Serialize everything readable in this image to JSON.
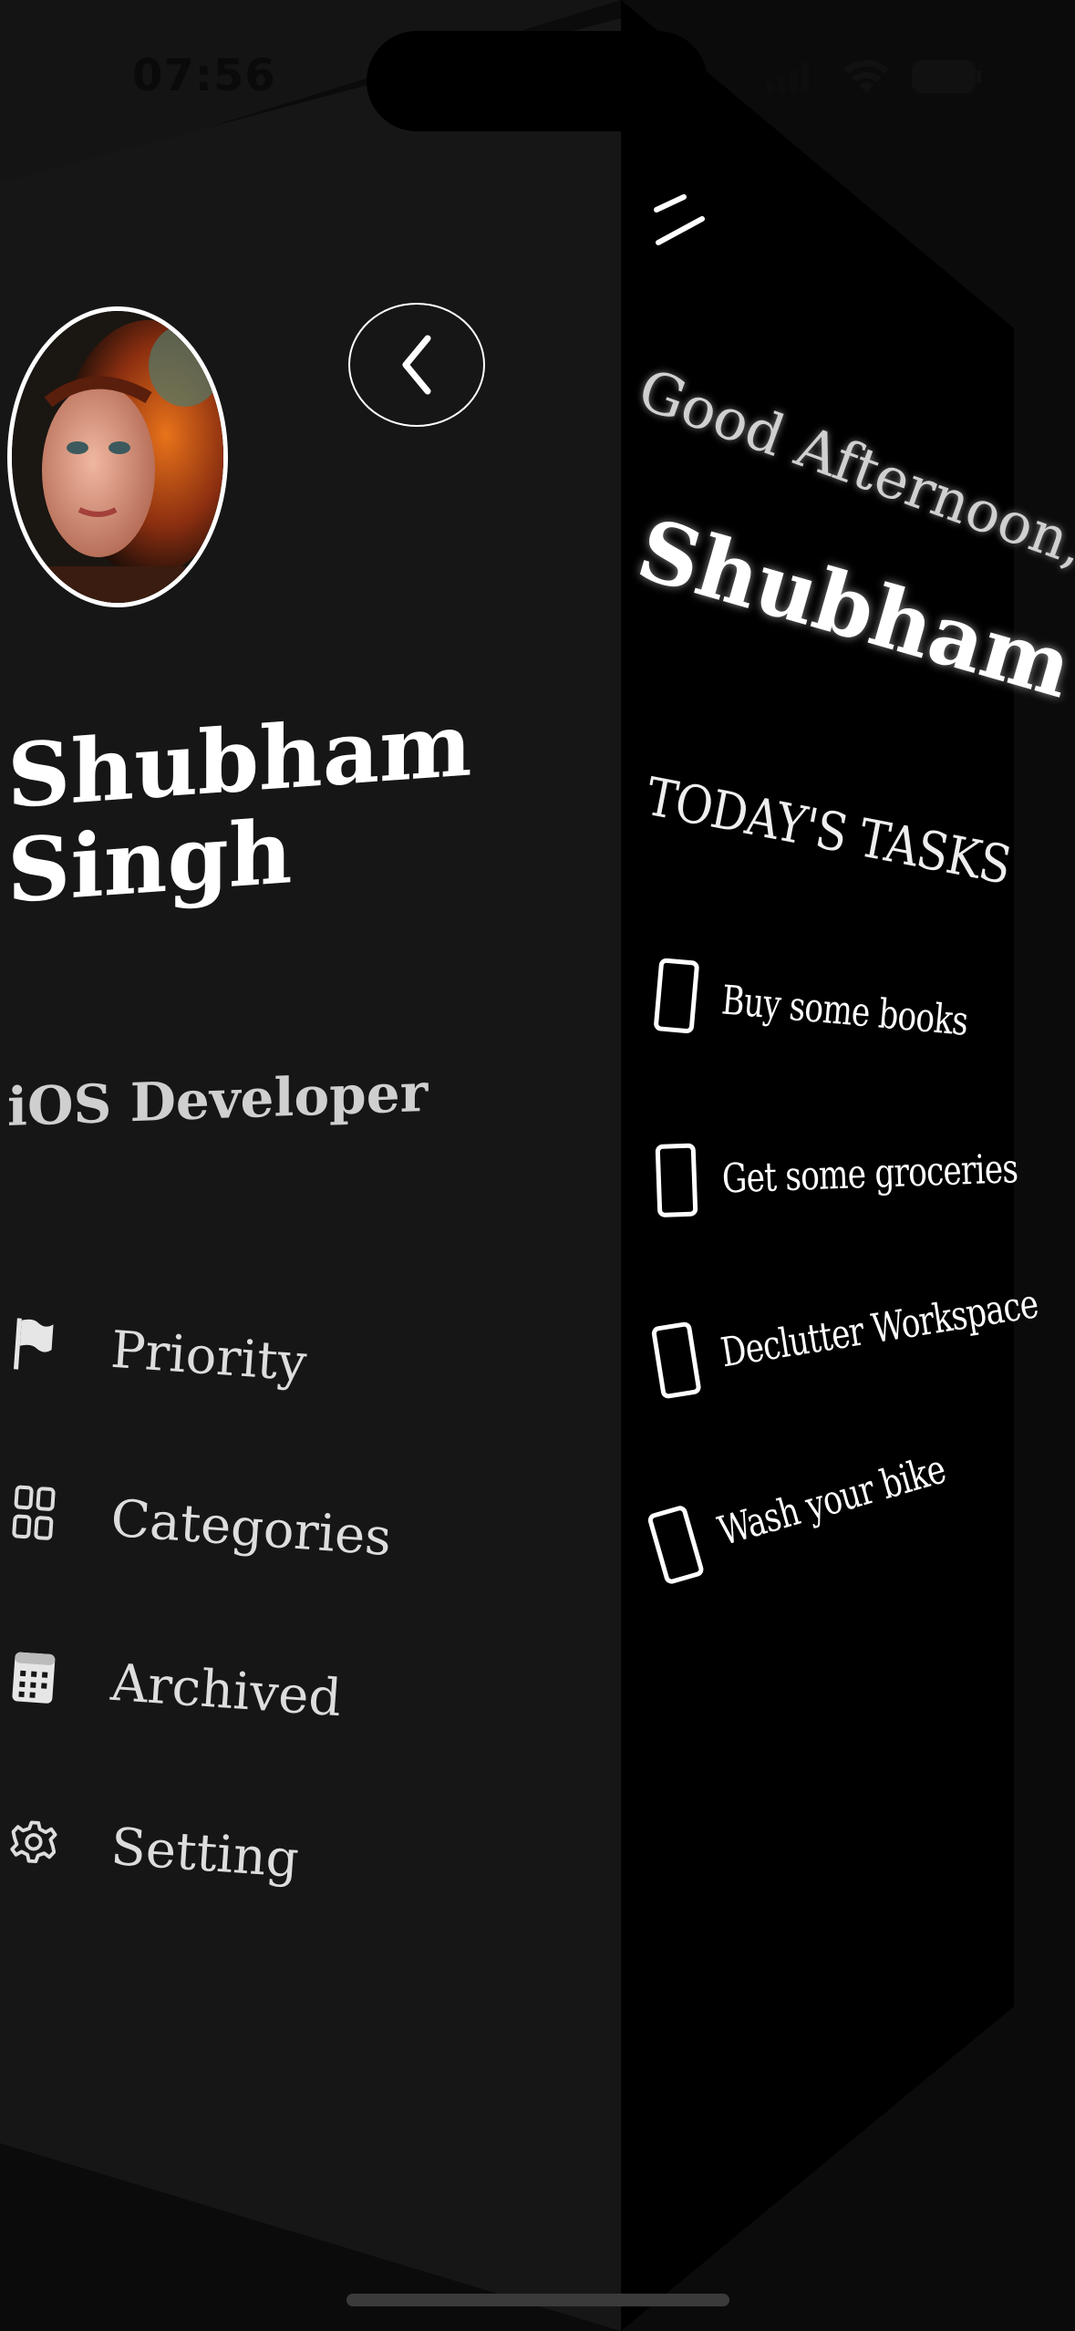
{
  "status_bar": {
    "time": "07:56",
    "icons": [
      "cellular-icon",
      "wifi-icon",
      "battery-icon"
    ]
  },
  "drawer": {
    "avatar_alt": "profile-avatar",
    "back_icon": "chevron-left-icon",
    "name_line1": "Shubham",
    "name_line2": "Singh",
    "role": "iOS Developer",
    "menu": [
      {
        "label": "Priority",
        "icon": "flag-icon"
      },
      {
        "label": "Categories",
        "icon": "grid-icon"
      },
      {
        "label": "Archived",
        "icon": "calendar-icon"
      },
      {
        "label": "Setting",
        "icon": "gear-icon"
      }
    ]
  },
  "main": {
    "menu_icon": "menu-toggle-icon",
    "greeting": "Good Afternoon,",
    "user_name": "Shubham",
    "tasks_title": "TODAY'S TASKS",
    "tasks": [
      {
        "text": "Buy some books",
        "done": false
      },
      {
        "text": "Get some groceries",
        "done": false
      },
      {
        "text": "Declutter Workspace",
        "done": false
      },
      {
        "text": "Wash your bike",
        "done": false
      }
    ]
  },
  "colors": {
    "drawer_bg": "#161616",
    "main_bg": "#000000",
    "text_primary": "#ffffff",
    "text_secondary": "#cfcfcf"
  }
}
